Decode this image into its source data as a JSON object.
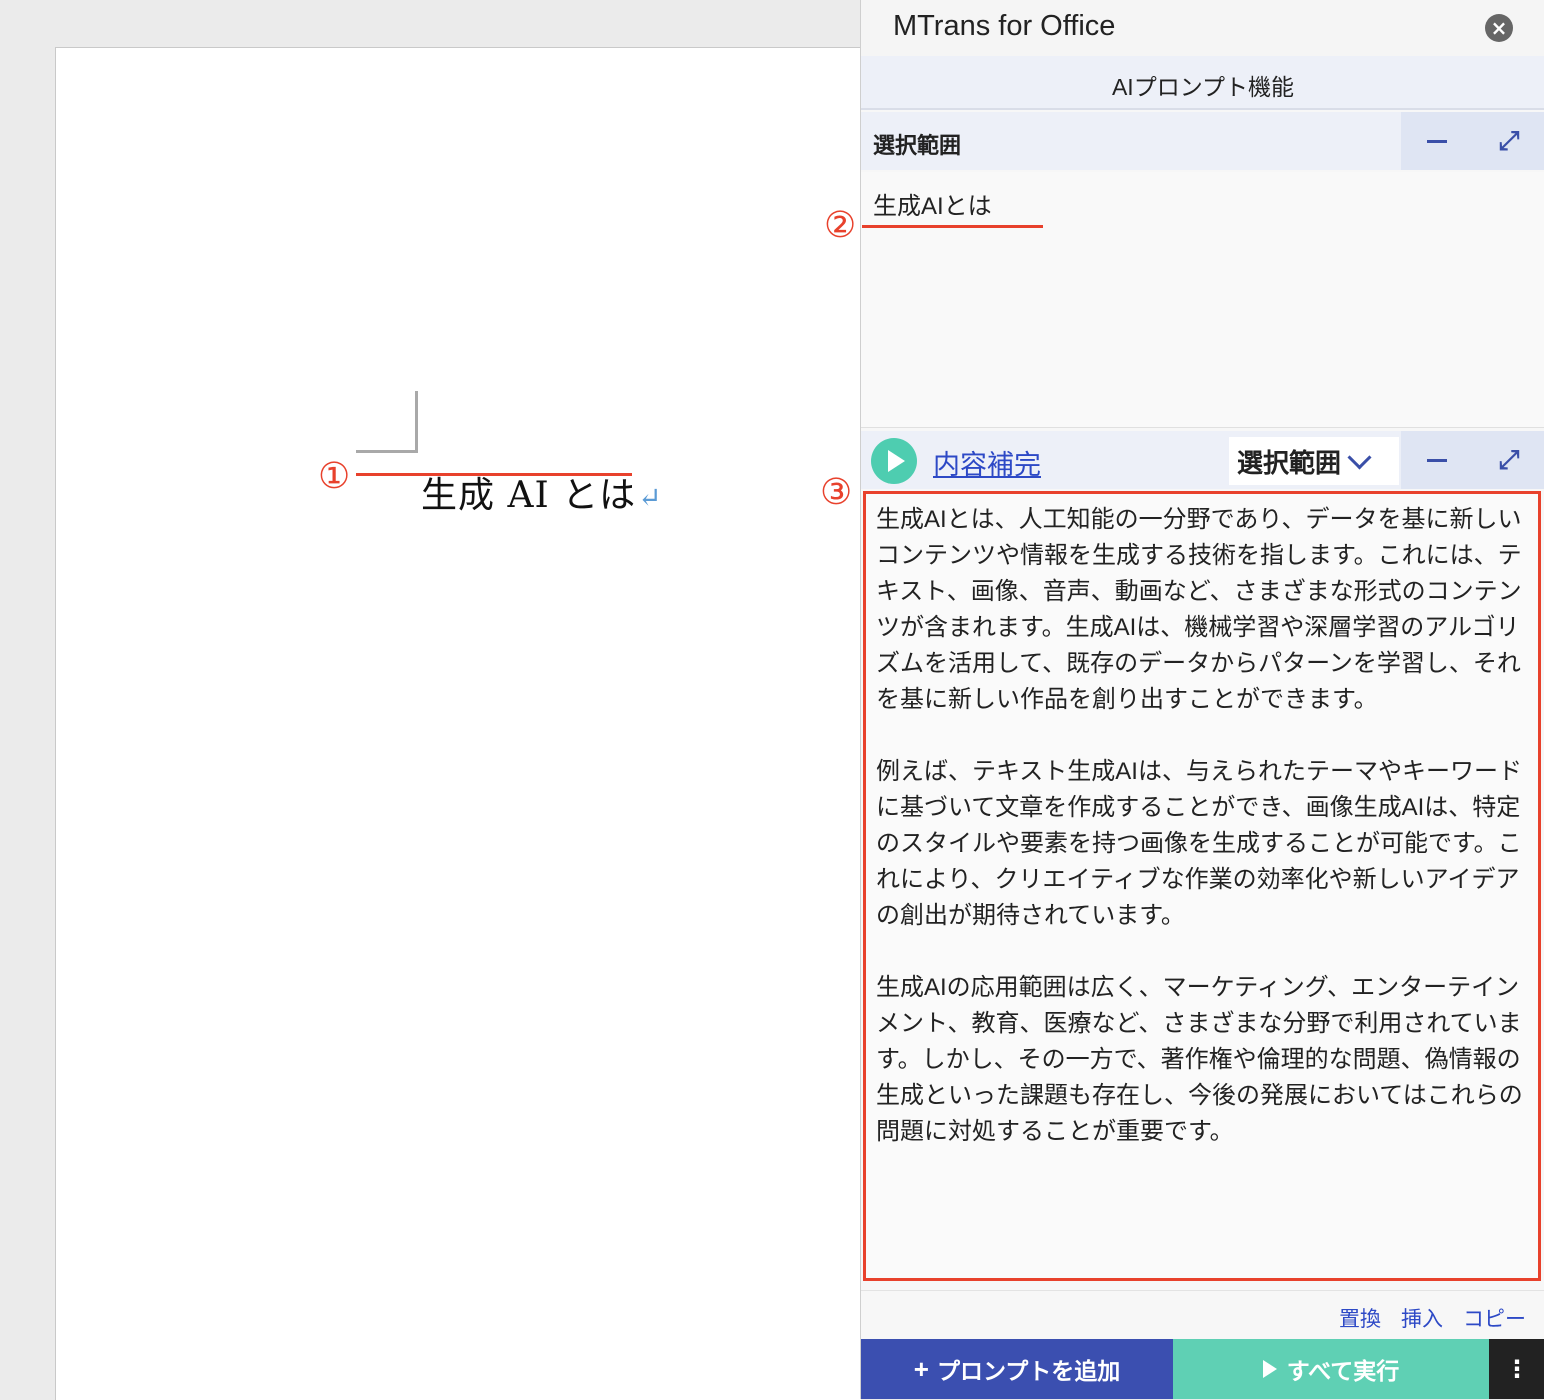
{
  "document": {
    "heading": "生成 AI とは",
    "paragraph_mark": "↵"
  },
  "annotations": {
    "n1": "①",
    "n2": "②",
    "n3": "③",
    "color": "#e8412c"
  },
  "panel": {
    "title": "MTrans for Office",
    "close_icon": "×",
    "mode": "AIプロンプト機能",
    "selection_section": {
      "title": "選択範囲",
      "minimize": "minus-icon",
      "expand": "expand-icon",
      "text": "生成AIとは"
    },
    "prompt": {
      "name": "内容補完",
      "scope": "選択範囲",
      "output": "生成AIとは、人工知能の一分野であり、データを基に新しいコンテンツや情報を生成する技術を指します。これには、テキスト、画像、音声、動画など、さまざまな形式のコンテンツが含まれます。生成AIは、機械学習や深層学習のアルゴリズムを活用して、既存のデータからパターンを学習し、それを基に新しい作品を創り出すことができます。\n\n例えば、テキスト生成AIは、与えられたテーマやキーワードに基づいて文章を作成することができ、画像生成AIは、特定のスタイルや要素を持つ画像を生成することが可能です。これにより、クリエイティブな作業の効率化や新しいアイデアの創出が期待されています。\n\n生成AIの応用範囲は広く、マーケティング、エンターテインメント、教育、医療など、さまざまな分野で利用されています。しかし、その一方で、著作権や倫理的な問題、偽情報の生成といった課題も存在し、今後の発展においてはこれらの問題に対処することが重要です。"
    },
    "actions": {
      "replace": "置換",
      "insert": "挿入",
      "copy": "コピー"
    },
    "footer": {
      "add_prompt": "プロンプトを追加",
      "run_all": "すべて実行",
      "more": "⋮"
    },
    "colors": {
      "accent_blue": "#3b4fb0",
      "run_green": "#5fd0b4",
      "play_green": "#4ecdb0",
      "link_blue": "#2d49c6"
    }
  }
}
